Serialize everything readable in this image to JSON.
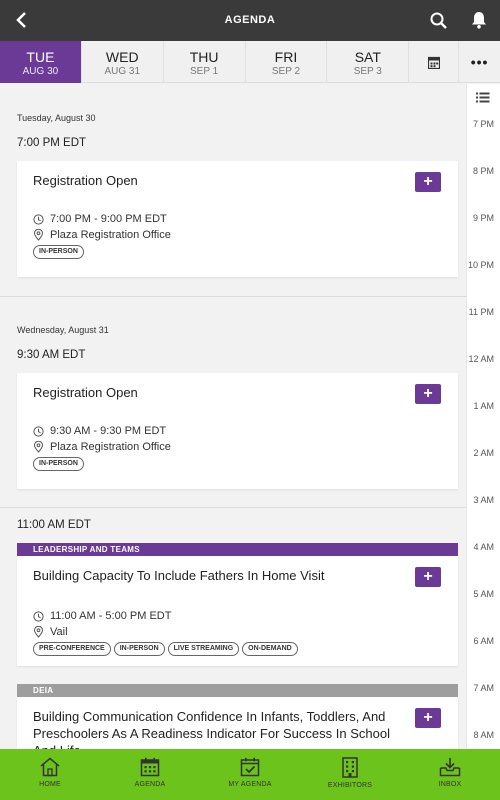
{
  "header": {
    "title": "AGENDA",
    "back_icon": "chevron-left-icon",
    "search_icon": "search-icon",
    "notifications_icon": "bell-icon"
  },
  "day_tabs": [
    {
      "day": "TUE",
      "date": "AUG 30",
      "active": true
    },
    {
      "day": "WED",
      "date": "AUG 31",
      "active": false
    },
    {
      "day": "THU",
      "date": "SEP 1",
      "active": false
    },
    {
      "day": "FRI",
      "date": "SEP 2",
      "active": false
    },
    {
      "day": "SAT",
      "date": "SEP 3",
      "active": false
    }
  ],
  "tab_icons": {
    "calendar": "calendar-icon",
    "more": "•••"
  },
  "agenda": {
    "day1": {
      "label": "Tuesday, August 30",
      "time": "7:00 PM EDT",
      "session": {
        "title": "Registration Open",
        "time": "7:00 PM - 9:00 PM EDT",
        "location": "Plaza Registration Office",
        "tags": [
          "IN-PERSON"
        ],
        "add_label": "+"
      }
    },
    "day2": {
      "label": "Wednesday, August 31",
      "time": "9:30 AM EDT",
      "session": {
        "title": "Registration Open",
        "time": "9:30 AM - 9:30 PM EDT",
        "location": "Plaza Registration Office",
        "tags": [
          "IN-PERSON"
        ],
        "add_label": "+"
      }
    },
    "slot3": {
      "time": "11:00 AM EDT",
      "session_a": {
        "track": "LEADERSHIP AND TEAMS",
        "track_color": "#6b3a96",
        "title": "Building Capacity To Include Fathers In Home Visit",
        "time": "11:00 AM - 5:00 PM EDT",
        "location": "Vail",
        "tags": [
          "PRE-CONFERENCE",
          "IN-PERSON",
          "LIVE STREAMING",
          "ON-DEMAND"
        ],
        "add_label": "+"
      },
      "session_b": {
        "track": "DEIA",
        "track_color": "#9e9e9e",
        "title": "Building Communication Confidence In Infants, Toddlers, And Preschoolers As A Readiness Indicator For Success In School And Life",
        "add_label": "+"
      }
    }
  },
  "timeline": {
    "icon": "list-icon",
    "labels": [
      "7 PM",
      "8 PM",
      "9 PM",
      "10 PM",
      "11 PM",
      "12 AM",
      "1 AM",
      "2 AM",
      "3 AM",
      "4 AM",
      "5 AM",
      "6 AM",
      "7 AM",
      "8 AM"
    ]
  },
  "bottom_nav": [
    {
      "label": "HOME",
      "icon": "home-icon"
    },
    {
      "label": "AGENDA",
      "icon": "calendar-icon"
    },
    {
      "label": "MY AGENDA",
      "icon": "calendar-check-icon"
    },
    {
      "label": "EXHIBITORS",
      "icon": "building-icon"
    },
    {
      "label": "INBOX",
      "icon": "inbox-icon"
    }
  ],
  "colors": {
    "accent": "#6b3a96",
    "topbar": "#3a3a3a",
    "bottom_nav": "#6cc31c"
  }
}
